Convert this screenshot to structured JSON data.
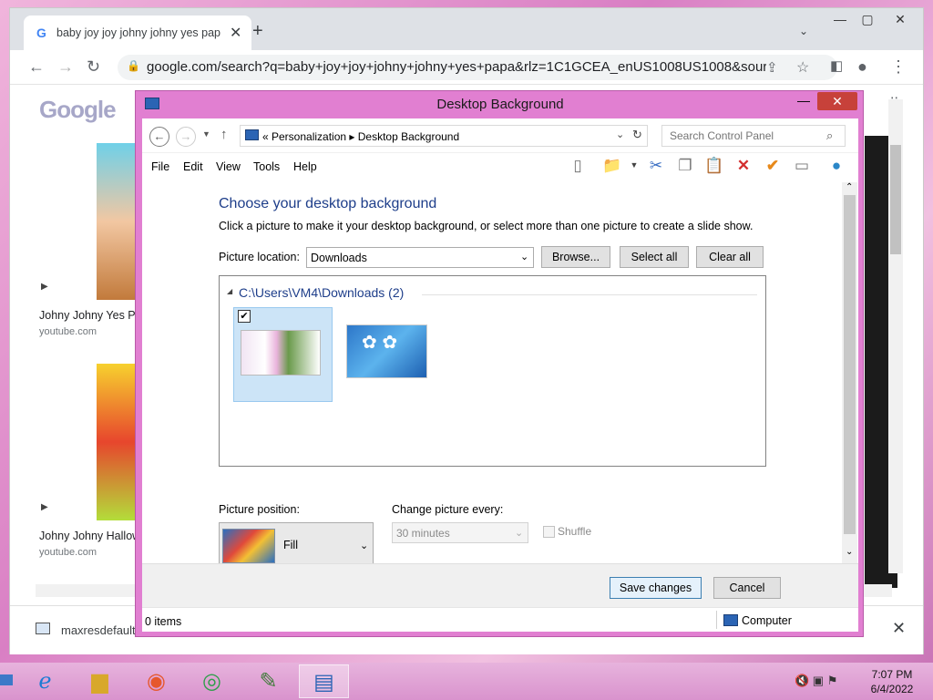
{
  "browser": {
    "tab_title": "baby joy joy johny johny yes pap",
    "tab_close": "✕",
    "new_tab": "+",
    "tab_menu": "⌄",
    "url": "google.com/search?q=baby+joy+joy+johny+johny+yes+papa&rlz=1C1GCEA_enUS1008US1008&source=...",
    "results": [
      {
        "title": "Johny Johny Yes Pa",
        "source": "youtube.com"
      },
      {
        "title": "Johny Johny Hallow",
        "source": "youtube.com"
      }
    ],
    "download_name": "maxresdefault",
    "download_close": "✕",
    "logo": "Google"
  },
  "dialog": {
    "title": "Desktop Background",
    "breadcrumb": "«   Personalization   ▸   Desktop Background",
    "search_placeholder": "Search Control Panel",
    "menu": [
      "File",
      "Edit",
      "View",
      "Tools",
      "Help"
    ],
    "heading": "Choose your desktop background",
    "subheading": "Click a picture to make it your desktop background, or select more than one picture to create a slide show.",
    "picture_location_label": "Picture location:",
    "picture_location_value": "Downloads",
    "browse_label": "Browse...",
    "select_all_label": "Select all",
    "clear_all_label": "Clear all",
    "group_title": "C:\\Users\\VM4\\Downloads (2)",
    "picture_position_label": "Picture position:",
    "picture_position_value": "Fill",
    "change_picture_label": "Change picture every:",
    "change_picture_value": "30 minutes",
    "shuffle_label": "Shuffle",
    "save_label": "Save changes",
    "cancel_label": "Cancel",
    "status_items": "0 items",
    "status_location": "Computer"
  },
  "taskbar": {
    "time": "7:07 PM",
    "date": "6/4/2022"
  },
  "colors": {
    "accent": "#1e3e8a",
    "dialog_frame": "#e17fd1",
    "close_button": "#c7413a"
  }
}
